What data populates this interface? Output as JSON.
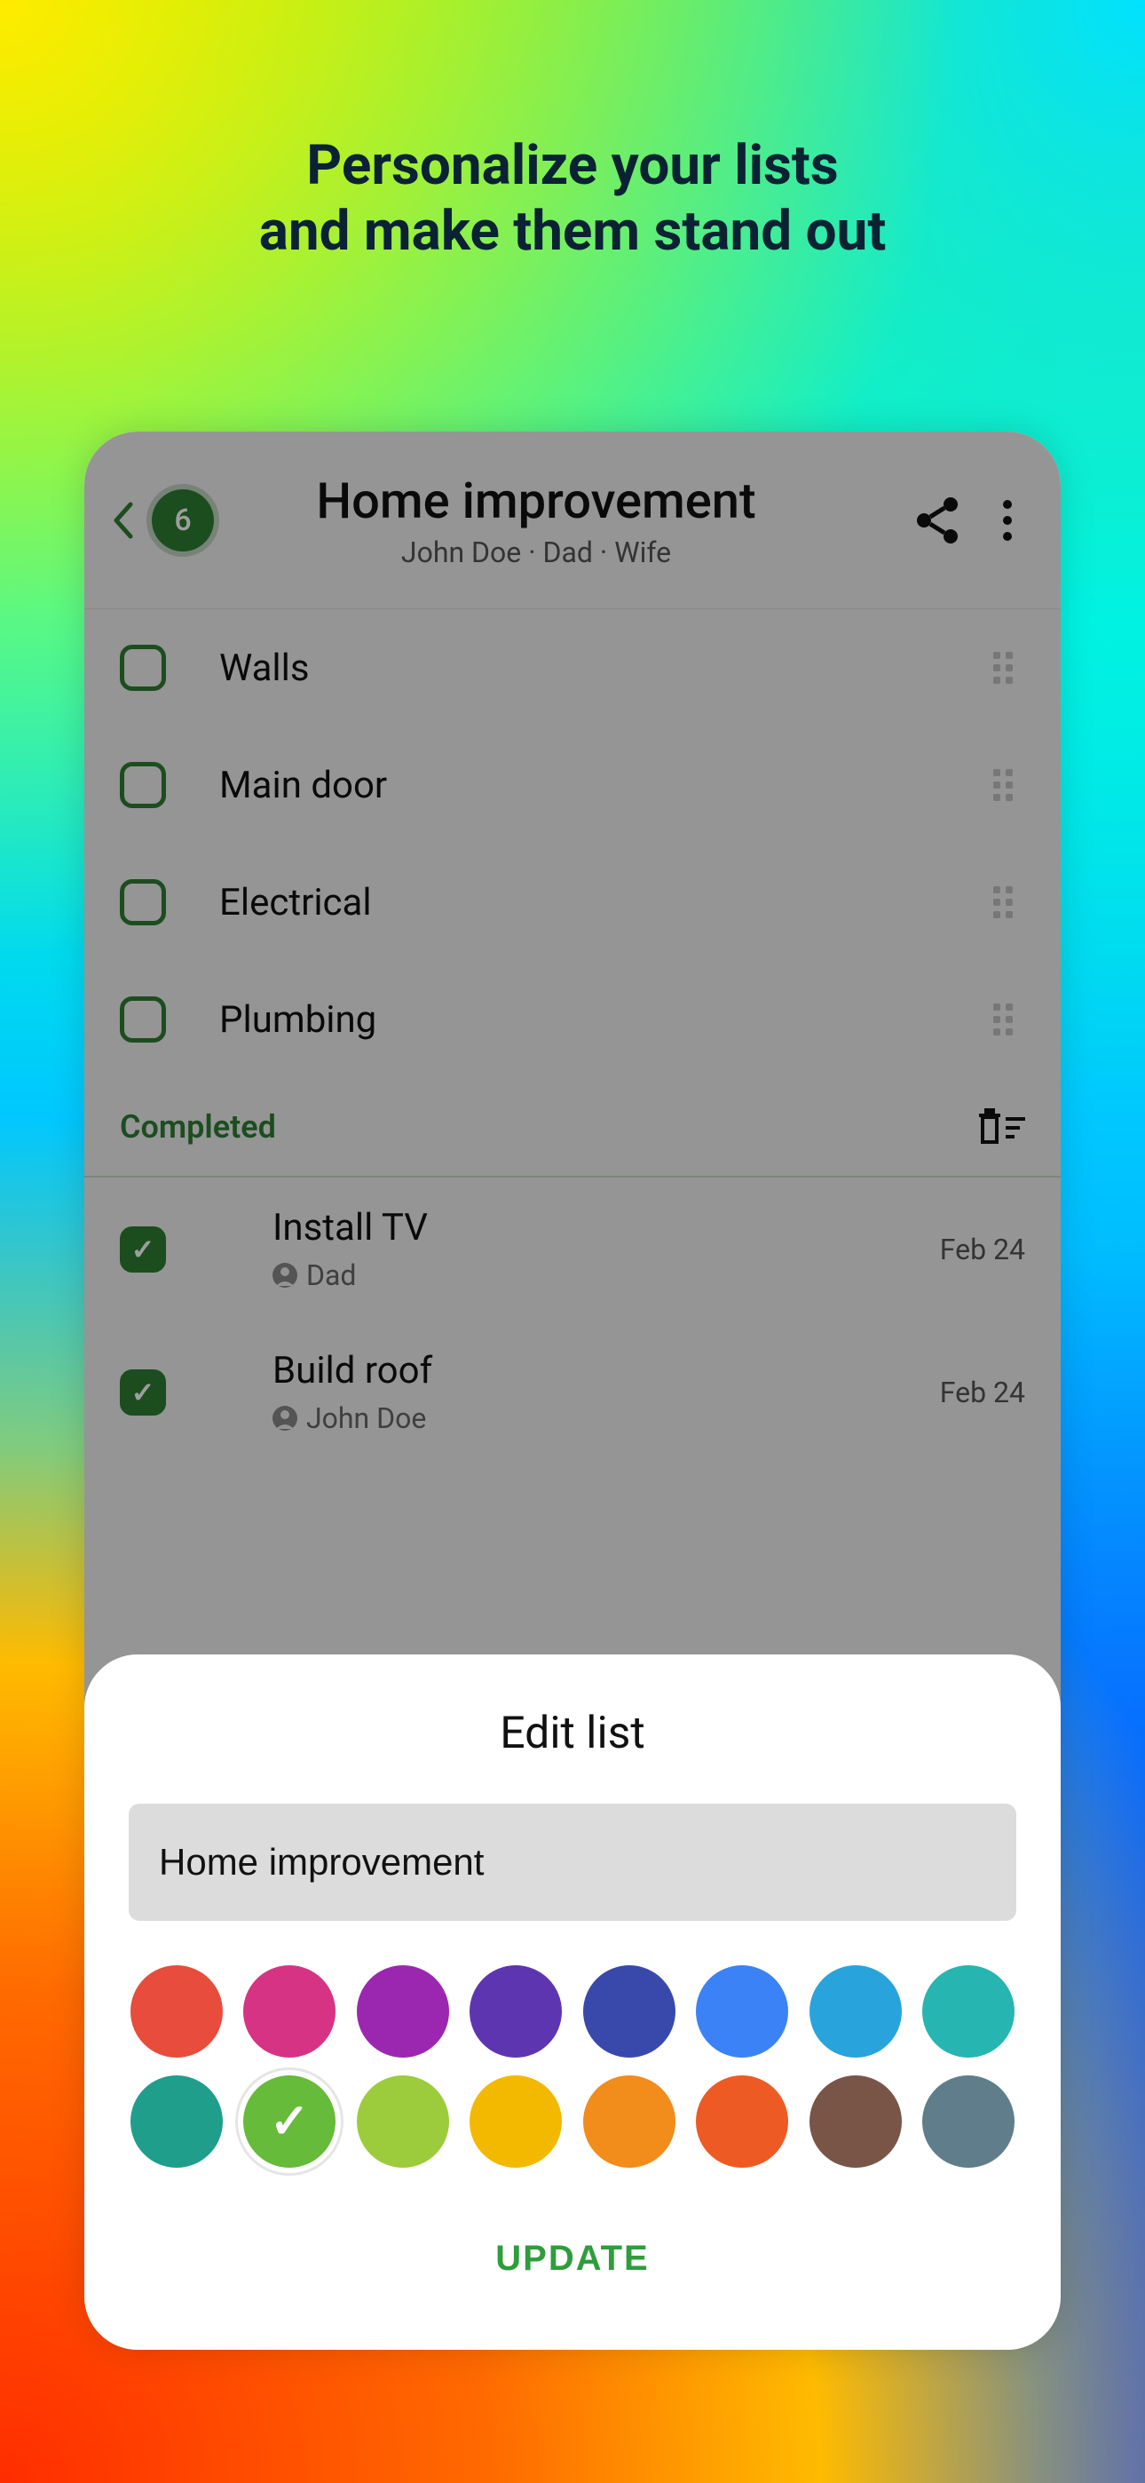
{
  "headline_line1": "Personalize your lists",
  "headline_line2": "and make them stand out",
  "header": {
    "count": "6",
    "title": "Home improvement",
    "members": "John Doe · Dad · Wife"
  },
  "tasks": [
    {
      "label": "Walls"
    },
    {
      "label": "Main door"
    },
    {
      "label": "Electrical"
    },
    {
      "label": "Plumbing"
    }
  ],
  "completed_label": "Completed",
  "completed": [
    {
      "title": "Install TV",
      "assignee": "Dad",
      "date": "Feb 24"
    },
    {
      "title": "Build roof",
      "assignee": "John Doe",
      "date": "Feb 24"
    }
  ],
  "sheet": {
    "title": "Edit list",
    "name_value": "Home improvement",
    "update_label": "UPDATE"
  },
  "colors": [
    "#e74c3c",
    "#d63384",
    "#9b27b0",
    "#5e35b1",
    "#3949ab",
    "#3b82f6",
    "#29a3dc",
    "#26b5b0",
    "#1f9e8c",
    "#66bb3a",
    "#9ccc3c",
    "#f3b900",
    "#f28c1b",
    "#ee5a24",
    "#795548",
    "#607d8b"
  ],
  "selected_color_index": 9
}
